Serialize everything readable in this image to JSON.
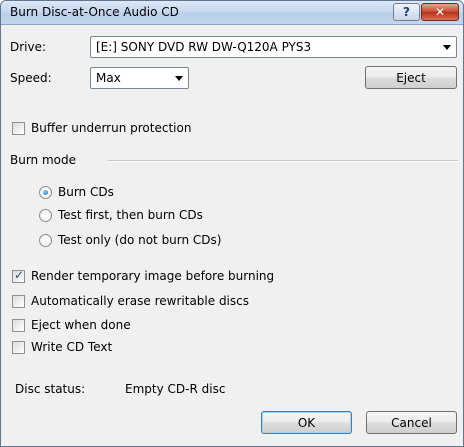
{
  "window": {
    "title": "Burn Disc-at-Once Audio CD",
    "help_label": "?",
    "close_label": "✕"
  },
  "drive": {
    "label": "Drive:",
    "value": "[E:] SONY DVD RW DW-Q120A PYS3"
  },
  "speed": {
    "label": "Speed:",
    "value": "Max"
  },
  "eject_label": "Eject",
  "buffer_underrun": {
    "label": "Buffer underrun protection",
    "checked": false
  },
  "burn_mode": {
    "label": "Burn mode",
    "options": [
      {
        "label": "Burn CDs",
        "selected": true
      },
      {
        "label": "Test first, then burn CDs",
        "selected": false
      },
      {
        "label": "Test only (do not burn CDs)",
        "selected": false
      }
    ]
  },
  "options": [
    {
      "label": "Render temporary image before burning",
      "checked": true
    },
    {
      "label": "Automatically erase rewritable discs",
      "checked": false
    },
    {
      "label": "Eject when done",
      "checked": false
    },
    {
      "label": "Write CD Text",
      "checked": false
    }
  ],
  "disc_status": {
    "label": "Disc status:",
    "value": "Empty CD-R disc"
  },
  "buttons": {
    "ok": "OK",
    "cancel": "Cancel"
  }
}
